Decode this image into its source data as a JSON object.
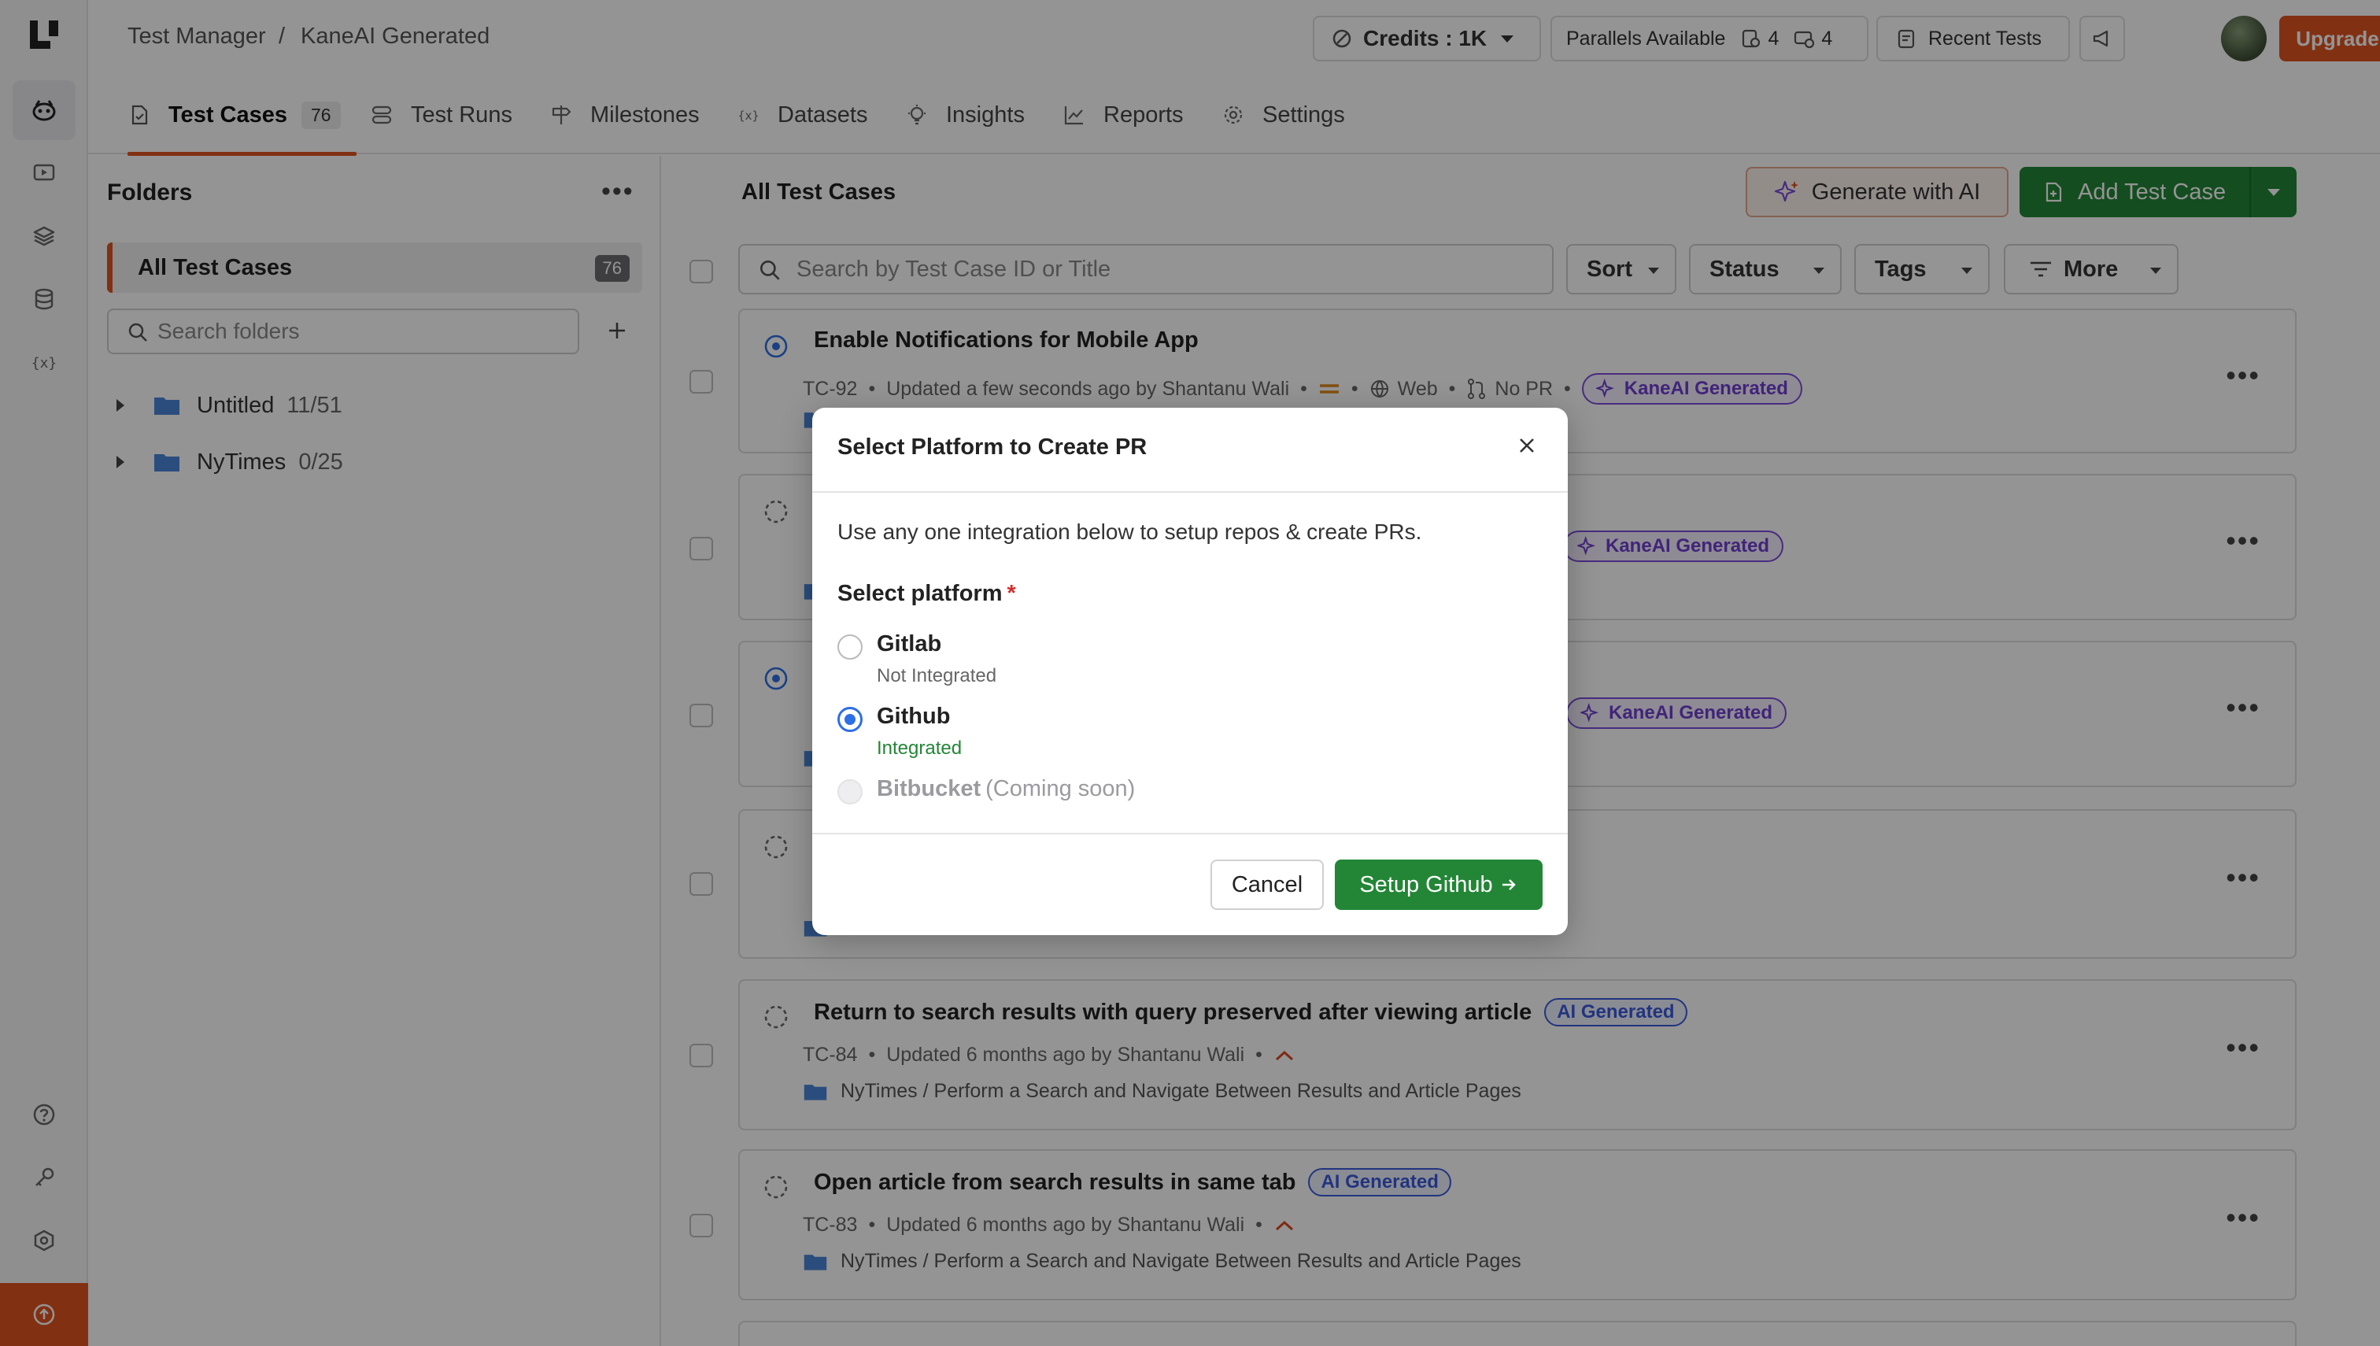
{
  "header": {
    "breadcrumb_root": "Test Manager",
    "breadcrumb_sep": "/",
    "breadcrumb_current": "KaneAI Generated",
    "credits_label": "Credits : 1K",
    "parallels_label": "Parallels Available",
    "parallels_web": "4",
    "parallels_mobile": "4",
    "recent_tests": "Recent Tests",
    "upgrade": "Upgrade Now"
  },
  "tabs": [
    {
      "label": "Test Cases",
      "count": "76"
    },
    {
      "label": "Test Runs"
    },
    {
      "label": "Milestones"
    },
    {
      "label": "Datasets"
    },
    {
      "label": "Insights"
    },
    {
      "label": "Reports"
    },
    {
      "label": "Settings"
    }
  ],
  "folders": {
    "title": "Folders",
    "all_label": "All Test Cases",
    "all_count": "76",
    "search_placeholder": "Search folders",
    "items": [
      {
        "name": "Untitled",
        "ratio": "11/51"
      },
      {
        "name": "NyTimes",
        "ratio": "0/25"
      }
    ]
  },
  "main": {
    "title": "All Test Cases",
    "generate_ai": "Generate with AI",
    "add_case": "Add Test Case",
    "search_placeholder": "Search by Test Case ID or Title",
    "filters": {
      "sort": "Sort",
      "status": "Status",
      "tags": "Tags",
      "more": "More"
    },
    "cards": [
      {
        "title": "Enable Notifications for Mobile App",
        "id": "TC-92",
        "updated": "Updated a few seconds ago by Shantanu Wali",
        "platform": "Web",
        "pr": "No PR",
        "tag": "KaneAI Generated"
      },
      {
        "tag": "KaneAI Generated"
      },
      {
        "tag": "KaneAI Generated"
      },
      {},
      {
        "title": "Return to search results with query preserved after viewing article",
        "tag": "AI Generated",
        "id": "TC-84",
        "updated": "Updated 6 months ago by Shantanu Wali",
        "path": "NyTimes / Perform a Search and Navigate Between Results and Article Pages"
      },
      {
        "title": "Open article from search results in same tab",
        "tag": "AI Generated",
        "id": "TC-83",
        "updated": "Updated 6 months ago by Shantanu Wali",
        "path": "NyTimes / Perform a Search and Navigate Between Results and Article Pages"
      }
    ]
  },
  "modal": {
    "title": "Select Platform to Create PR",
    "description": "Use any one integration below to setup repos & create PRs.",
    "platform_label": "Select platform",
    "required_mark": "*",
    "options": [
      {
        "name": "Gitlab",
        "status": "Not Integrated"
      },
      {
        "name": "Github",
        "status": "Integrated"
      },
      {
        "name": "Bitbucket",
        "note": "(Coming soon)"
      }
    ],
    "cancel": "Cancel",
    "setup": "Setup Github"
  },
  "colors": {
    "brand": "#e0541f",
    "primary_green": "#238636",
    "radio_blue": "#2e6ee6",
    "kane_purple": "#6f3fd0",
    "ai_blue": "#3b5bdb"
  }
}
